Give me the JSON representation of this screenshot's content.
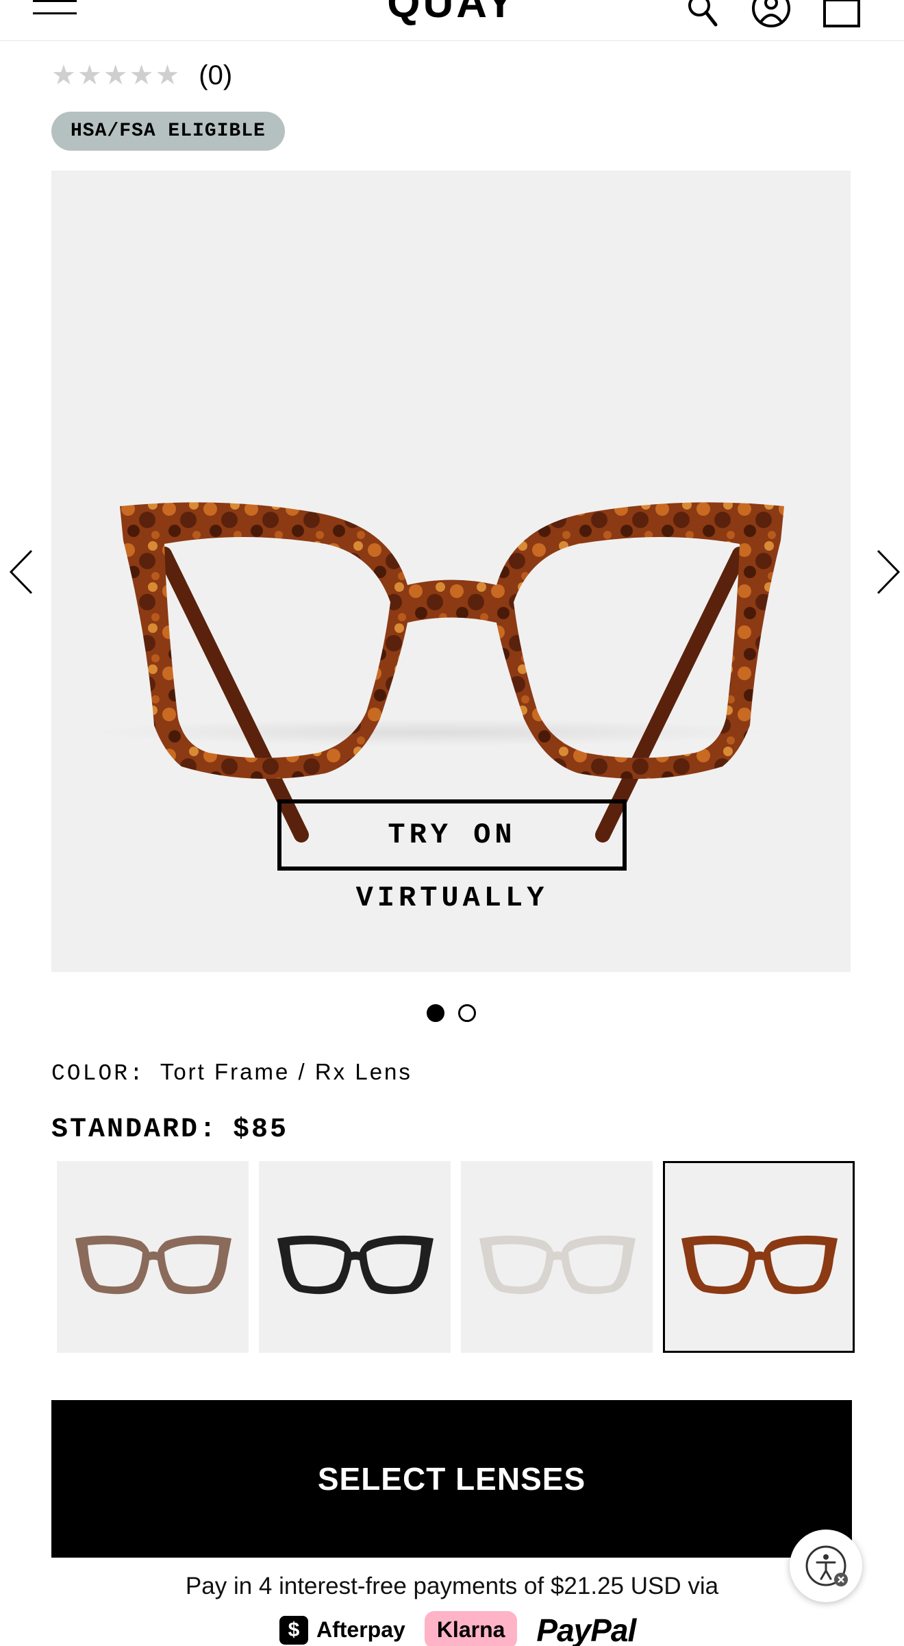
{
  "header": {
    "logo": "QUAY",
    "menu_icon": "hamburger-menu-icon",
    "search_icon": "search-icon",
    "account_icon": "account-icon",
    "cart_icon": "shopping-bag-icon"
  },
  "rating": {
    "stars": "★★★★★",
    "count": "(0)"
  },
  "badge": "HSA/FSA ELIGIBLE",
  "gallery": {
    "try_on_label": "TRY ON VIRTUALLY",
    "prev_icon": "chevron-left-icon",
    "next_icon": "chevron-right-icon",
    "current_slide": 1,
    "total_slides": 2
  },
  "product": {
    "color_label": "COLOR:",
    "color_value": "Tort Frame / Rx Lens",
    "standard_label": "STANDARD:",
    "price": "$85",
    "swatches": [
      {
        "name": "tortoise-light",
        "color": "#8a6a5a"
      },
      {
        "name": "black",
        "color": "#1f1f1f"
      },
      {
        "name": "clear",
        "color": "#d8d4d0"
      },
      {
        "name": "tort",
        "color": "#8b3a14",
        "selected": true
      }
    ]
  },
  "cta": {
    "select_lenses": "SELECT LENSES"
  },
  "payment": {
    "text_prefix": "Pay in 4 interest-free payments of ",
    "amount": "$21.25 USD",
    "text_suffix": " via",
    "afterpay": "Afterpay",
    "klarna": "Klarna",
    "paypal": "PayPal"
  },
  "accessibility_icon": "accessibility-icon",
  "colors": {
    "badge_bg": "#b5c1c0",
    "gallery_bg": "#f1f0f0",
    "klarna_pink": "#ffb3c7",
    "cta_bg": "#000000"
  }
}
